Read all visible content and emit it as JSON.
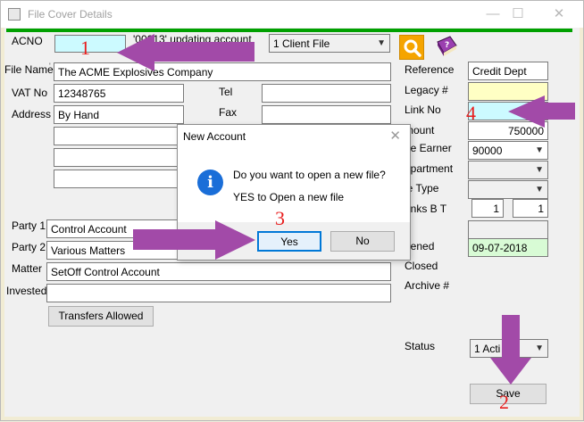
{
  "window": {
    "title": "File Cover Details"
  },
  "left": {
    "acno_label": "ACNO",
    "acno_value": "",
    "acno_status": "'00013' updating account",
    "client_file_option": "1 Client File",
    "file_name_label": "File Name",
    "file_name_value": "The ACME Explosives Company",
    "vat_label": "VAT No",
    "vat_value": "12348765",
    "tel_label": "Tel",
    "tel_value": "",
    "address_label": "Address",
    "address_lines": [
      "By Hand",
      "",
      "",
      ""
    ],
    "fax_label": "Fax",
    "fax_value": "",
    "party1_label": "Party 1",
    "party1_value": "Control Account",
    "party2_label": "Party 2",
    "party2_value": "Various Matters",
    "matter_label": "Matter",
    "matter_value": "SetOff Control Account",
    "invested_label": "Invested",
    "invested_value": "",
    "transfers_button": "Transfers Allowed"
  },
  "right": {
    "reference_label": "Reference",
    "reference_value": "Credit Dept",
    "legacy_label": "Legacy #",
    "legacy_value": "",
    "link_label": "Link No",
    "link_value": "",
    "amount_label": "mount",
    "amount_value": "750000",
    "fee_earner_label": "ee Earner",
    "fee_earner_value": "90000",
    "department_label": "epartment",
    "department_value": "",
    "file_type_label": "le Type",
    "file_type_value": "",
    "banks_label": "anks B T",
    "banks_value_1": "1",
    "banks_value_2": "1",
    "opened_label": "pened",
    "opened_value": "09-07-2018",
    "closed_label": "Closed",
    "archive_label": "Archive #",
    "status_label": "Status",
    "status_value": "1 Acti",
    "save_button": "Save"
  },
  "dialog": {
    "title": "New Account",
    "close_glyph": "✕",
    "info_glyph": "i",
    "message": "Do you want to open a new file?",
    "detail": "YES to Open a new file",
    "yes_label": "Yes",
    "no_label": "No"
  },
  "annotations": [
    "1",
    "2",
    "3",
    "4"
  ],
  "colors": {
    "accent_green": "#00a000",
    "arrow_purple": "#a24aa8",
    "annotation_red": "#e81d1d",
    "search_orange": "#f5a400"
  }
}
